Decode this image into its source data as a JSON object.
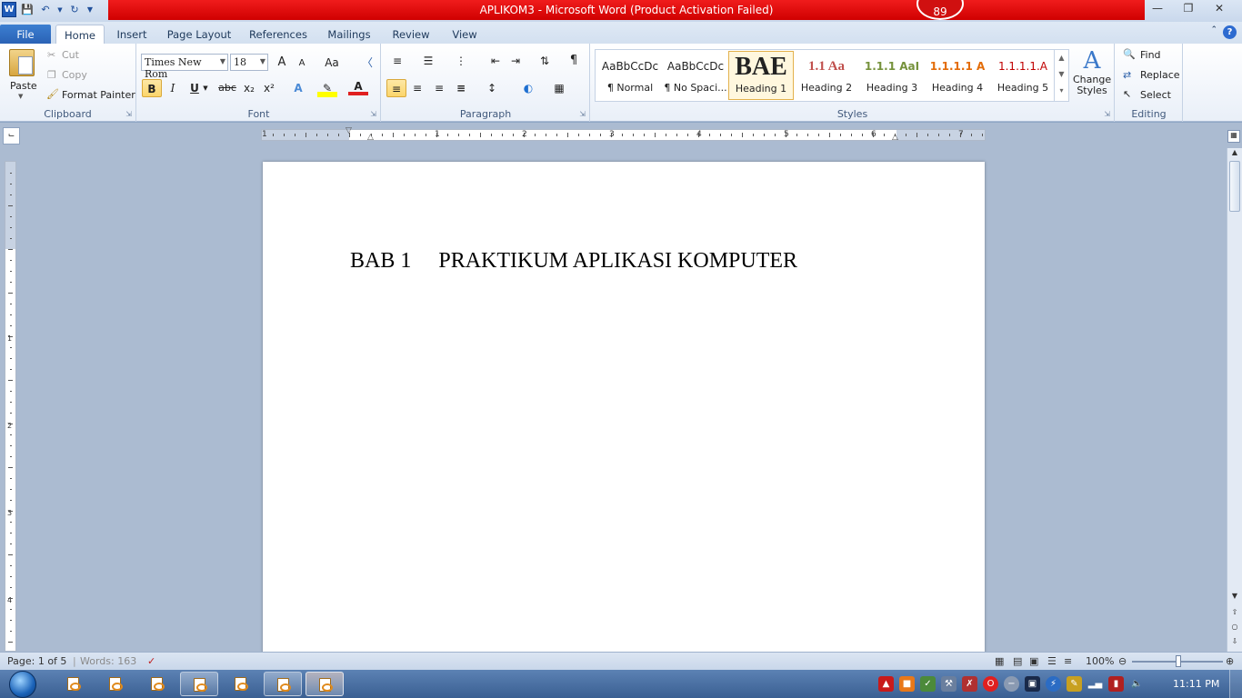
{
  "window": {
    "title": "APLIKOM3  -  Microsoft Word (Product Activation Failed)",
    "notification_count": "89",
    "qat": {
      "word_icon": "W"
    }
  },
  "tabs": [
    "File",
    "Home",
    "Insert",
    "Page Layout",
    "References",
    "Mailings",
    "Review",
    "View"
  ],
  "ribbon": {
    "clipboard": {
      "label": "Clipboard",
      "paste": "Paste",
      "cut": "Cut",
      "copy": "Copy",
      "format_painter": "Format Painter"
    },
    "font": {
      "label": "Font",
      "font_name": "Times New Rom",
      "font_size": "18",
      "bold": "B",
      "italic": "I",
      "underline": "U",
      "strike": "abc",
      "subscript": "x₂",
      "superscript": "x²",
      "change_case": "Aa",
      "grow": "A",
      "shrink": "A"
    },
    "paragraph": {
      "label": "Paragraph",
      "pilcrow": "¶"
    },
    "styles": {
      "label": "Styles",
      "items": [
        {
          "preview": "AaBbCcDc",
          "name": "¶ Normal"
        },
        {
          "preview": "AaBbCcDc",
          "name": "¶ No Spaci..."
        },
        {
          "preview": "BAE",
          "name": "Heading 1"
        },
        {
          "preview": "1.1  Aa",
          "name": "Heading 2"
        },
        {
          "preview": "1.1.1  AaI",
          "name": "Heading 3"
        },
        {
          "preview": "1.1.1.1  A",
          "name": "Heading 4"
        },
        {
          "preview": "1.1.1.1.A",
          "name": "Heading 5"
        }
      ],
      "change_styles": "Change Styles"
    },
    "editing": {
      "label": "Editing",
      "find": "Find",
      "replace": "Replace",
      "select": "Select"
    }
  },
  "document": {
    "heading": "BAB 1     PRAKTIKUM APLIKASI KOMPUTER",
    "ruler_numbers": [
      "1",
      "1",
      "2",
      "3",
      "4",
      "5",
      "6",
      "7"
    ],
    "vruler_numbers": [
      "1",
      "2",
      "3",
      "4"
    ]
  },
  "status": {
    "page": "Page: 1 of 5",
    "words": "Words: 163",
    "zoom": "100%"
  },
  "taskbar": {
    "clock": "11:11 PM"
  },
  "colors": {
    "titlebar_red": "#e00000",
    "accent": "#2a62b5"
  }
}
